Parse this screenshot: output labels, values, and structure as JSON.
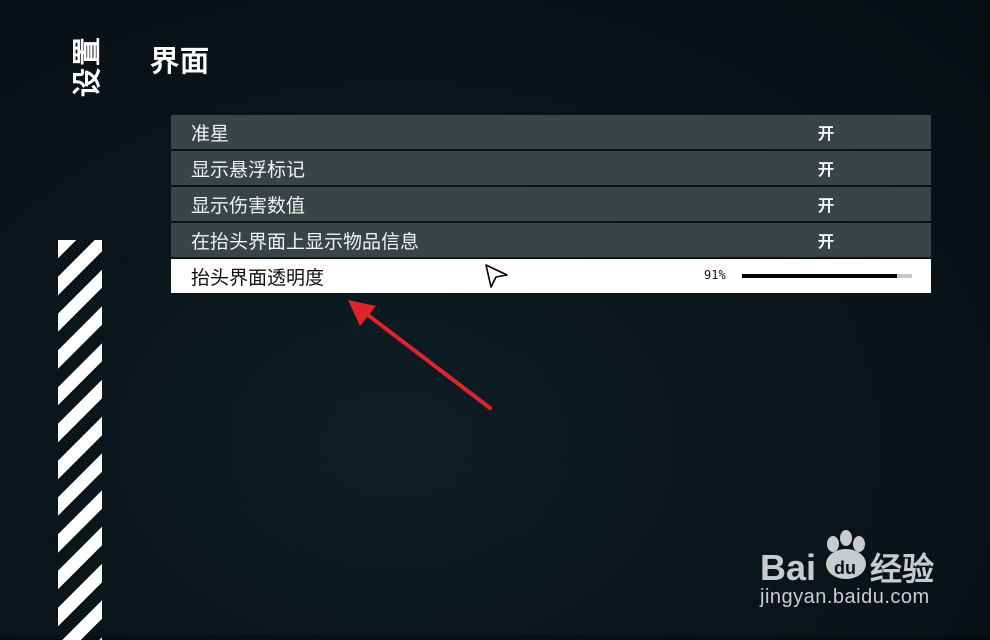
{
  "sidebar": {
    "label": "设置"
  },
  "page": {
    "title": "界面"
  },
  "settings": [
    {
      "label": "准星",
      "value": "开"
    },
    {
      "label": "显示悬浮标记",
      "value": "开"
    },
    {
      "label": "显示伤害数值",
      "value": "开"
    },
    {
      "label": "在抬头界面上显示物品信息",
      "value": "开"
    }
  ],
  "opacity_setting": {
    "label": "抬头界面透明度",
    "value_text": "91%",
    "level": 0.91
  },
  "watermark": {
    "brand_logo": "Bai du 经验",
    "url": "jingyan.baidu.com"
  },
  "colors": {
    "row_background": "#3a4447",
    "selected_row_background": "#ffffff",
    "annotation_arrow": "#e0242b",
    "page_background": "#0b161c"
  },
  "icons": {
    "cursor": "mouse-pointer-icon",
    "annotation": "red-arrow-icon",
    "watermark_logo": "baidu-paw-icon"
  }
}
